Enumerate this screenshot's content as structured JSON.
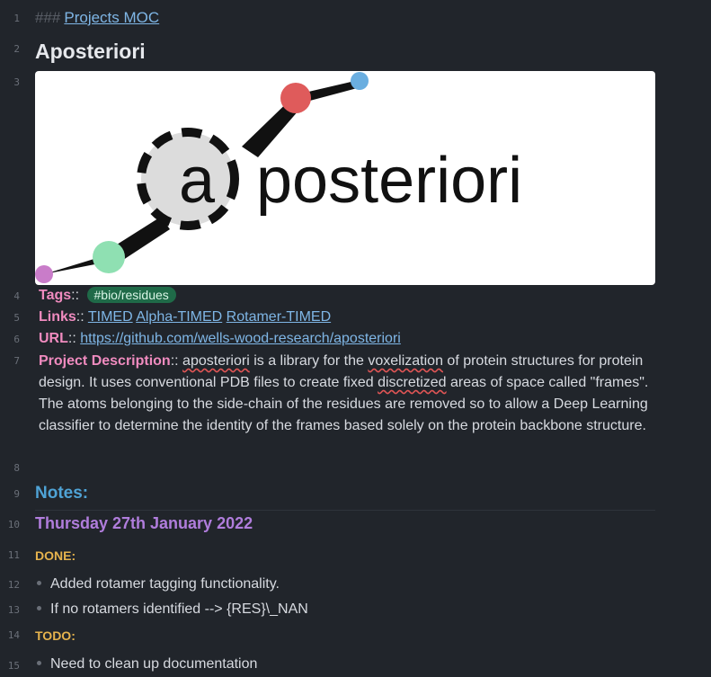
{
  "lines": {
    "n1": "1",
    "n2": "2",
    "n3": "3",
    "n4": "4",
    "n5": "5",
    "n6": "6",
    "n7": "7",
    "n8": "8",
    "n9": "9",
    "n10": "10",
    "n11": "11",
    "n12": "12",
    "n13": "13",
    "n14": "14",
    "n15": "15"
  },
  "heading3": {
    "hashes": "###",
    "link": "Projects MOC"
  },
  "title": "Aposteriori",
  "logo": {
    "text_a": "a",
    "text_rest": "posteriori"
  },
  "tags": {
    "key": "Tags",
    "sep": "::",
    "tag": "#bio/residues"
  },
  "links": {
    "key": "Links",
    "sep": "::",
    "items": [
      "TIMED",
      "Alpha-TIMED",
      "Rotamer-TIMED"
    ]
  },
  "url": {
    "key": "URL",
    "sep": "::",
    "value": "https://github.com/wells-wood-research/aposteriori"
  },
  "description": {
    "key": "Project Description",
    "sep": "::",
    "word1": "aposteriori",
    "part1": " is a library for the ",
    "word2": "voxelization",
    "part2": " of protein structures for protein design. It uses conventional PDB files to create fixed ",
    "word3": "discretized",
    "part3": " areas of space called \"frames\". The atoms belonging to the side-chain of the residues are removed so to allow a Deep Learning classifier to determine the identity of the frames based solely on the protein backbone structure."
  },
  "notes": {
    "heading": "Notes:",
    "date": "Thursday 27th January 2022"
  },
  "done": {
    "label": "DONE:",
    "items": [
      "Added rotamer tagging functionality.",
      "If no rotamers identified --> {RES}\\_NAN"
    ]
  },
  "todo": {
    "label": "TODO:",
    "items": [
      "Need to clean up documentation"
    ]
  }
}
